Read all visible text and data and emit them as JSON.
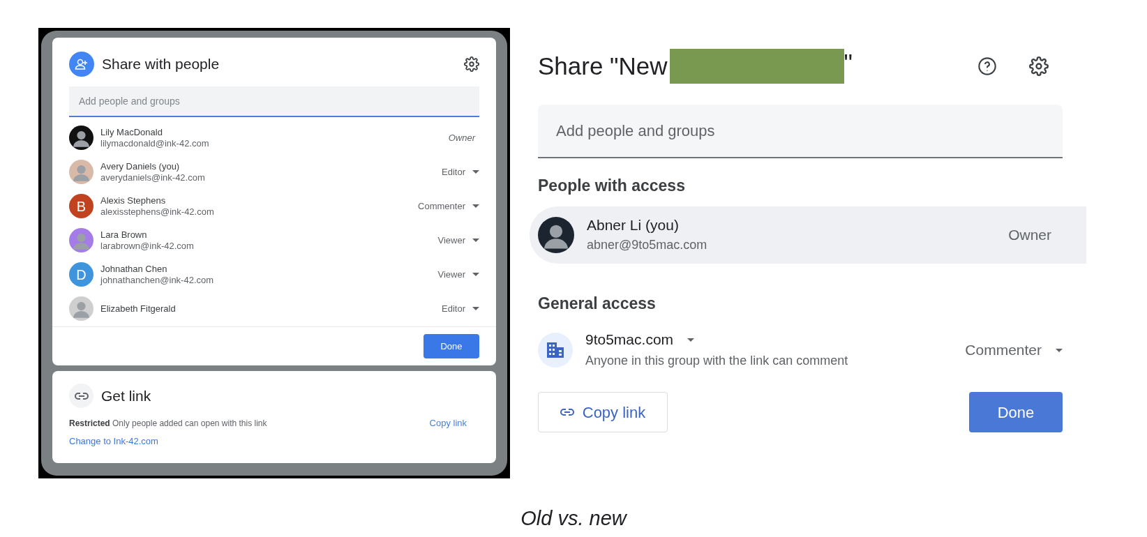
{
  "old_dialog": {
    "title": "Share with people",
    "search": {
      "placeholder": "Add people and groups"
    },
    "people": [
      {
        "name": "Lily MacDonald",
        "email": "lilymacdonald@ink-42.com",
        "role": "Owner",
        "kind": "fixed",
        "avatar": {
          "kind": "photo",
          "color": "#111111"
        }
      },
      {
        "name": "Avery Daniels (you)",
        "email": "averydaniels@ink-42.com",
        "role": "Editor",
        "kind": "menu",
        "avatar": {
          "kind": "photo",
          "color": "#d9b9a8"
        }
      },
      {
        "name": "Alexis Stephens",
        "email": "alexisstephens@ink-42.com",
        "role": "Commenter",
        "kind": "menu",
        "avatar": {
          "kind": "letter",
          "letter": "B",
          "color": "#c0421f"
        }
      },
      {
        "name": "Lara Brown",
        "email": "larabrown@ink-42.com",
        "role": "Viewer",
        "kind": "menu",
        "avatar": {
          "kind": "photo",
          "color": "#a57be8"
        }
      },
      {
        "name": "Johnathan Chen",
        "email": "johnathanchen@ink-42.com",
        "role": "Viewer",
        "kind": "menu",
        "avatar": {
          "kind": "letter",
          "letter": "D",
          "color": "#3f94de"
        }
      },
      {
        "name": "Elizabeth Fitgerald",
        "role": "Editor",
        "kind": "menu",
        "avatar": {
          "kind": "photo",
          "color": "#cfcfcf"
        }
      }
    ],
    "done_button": "Done",
    "get_link": {
      "title": "Get link",
      "description": "**Restricted** Only people added can open with this link",
      "copy_link": "Copy link",
      "change_link": "Change to Ink-42.com"
    }
  },
  "new_dialog": {
    "title_prefix": "Share \"New",
    "title_suffix": "\"",
    "search": {
      "placeholder": "Add people and groups"
    },
    "people_heading": "People with access",
    "people": [
      {
        "name": "Abner Li (you)",
        "email": "abner@9to5mac.com",
        "role": "Owner",
        "avatar": {
          "kind": "photo",
          "color": "#1c2430"
        }
      }
    ],
    "general_heading": "General access",
    "general": {
      "group": "9to5mac.com",
      "description": "Anyone in this group with the link can comment",
      "role": "Commenter"
    },
    "copy_link": "Copy link",
    "done_button": "Done"
  },
  "caption": "Old vs. new"
}
